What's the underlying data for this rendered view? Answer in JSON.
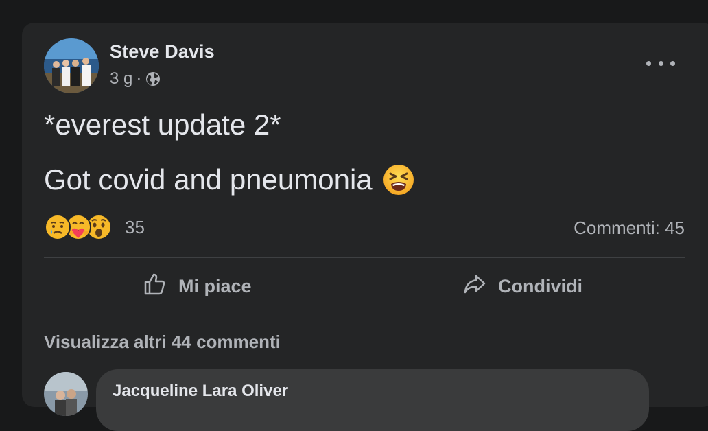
{
  "post": {
    "author": "Steve Davis",
    "time": "3 g",
    "separator": "·",
    "privacy_icon": "globe-icon",
    "more_icon": "more-dots-icon",
    "text_line1": "*everest update 2*",
    "text_line2": "Got covid and pneumonia",
    "inline_emoji": "tired-face-emoji"
  },
  "engagement": {
    "reaction_icons": [
      "sad-reaction",
      "care-reaction",
      "wow-reaction"
    ],
    "reaction_count": "35",
    "comments_label": "Commenti: 45"
  },
  "actions": {
    "like_label": "Mi piace",
    "share_label": "Condividi"
  },
  "comments": {
    "view_more_label": "Visualizza altri 44 commenti",
    "first_comment_author": "Jacqueline Lara Oliver"
  },
  "colors": {
    "page_bg": "#18191a",
    "card_bg": "#242526",
    "primary_text": "#e4e6eb",
    "secondary_text": "#b0b3b8",
    "bubble_bg": "#3a3b3c"
  }
}
